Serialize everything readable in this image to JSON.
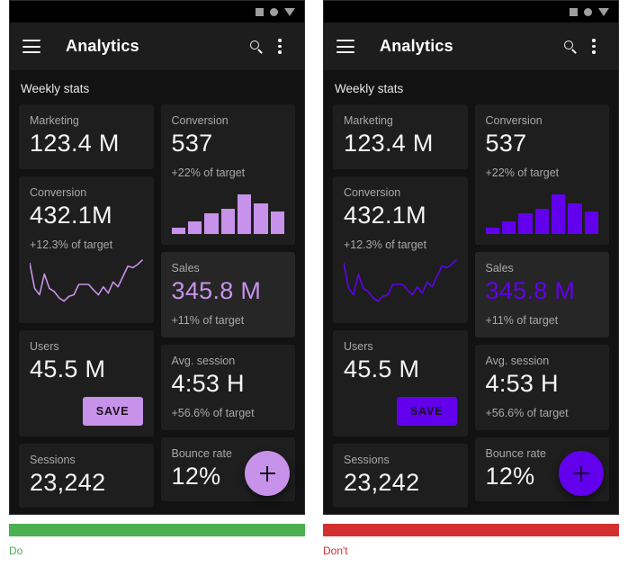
{
  "panels": [
    {
      "id": "do",
      "accent": "#c792ea",
      "verdict_color": "#4caf50",
      "verdict_label": "Do",
      "statusbar": {
        "icons": [
          "square-icon",
          "circle-icon",
          "triangle-down-icon"
        ]
      },
      "appbar": {
        "menu_icon": "hamburger-icon",
        "title": "Analytics",
        "search_icon": "search-icon",
        "overflow_icon": "more-vert-icon"
      },
      "section_title": "Weekly stats",
      "left_cards": [
        {
          "label": "Marketing",
          "value": "123.4 M",
          "sub": "",
          "type": "plain"
        },
        {
          "label": "Conversion",
          "value": "432.1M",
          "sub": "+12.3% of target",
          "type": "sparkline"
        },
        {
          "label": "Users",
          "value": "45.5 M",
          "sub": "",
          "type": "button",
          "button_label": "SAVE"
        },
        {
          "label": "Sessions",
          "value": "23,242",
          "sub": "",
          "type": "plain"
        }
      ],
      "right_cards": [
        {
          "label": "Conversion",
          "value": "537",
          "sub": "+22% of target",
          "type": "barchart"
        },
        {
          "label": "Sales",
          "value": "345.8 M",
          "sub": "+11% of target",
          "type": "accent"
        },
        {
          "label": "Avg. session",
          "value": "4:53 H",
          "sub": "+56.6% of target",
          "type": "plain"
        },
        {
          "label": "Bounce rate",
          "value": "12%",
          "sub": "",
          "type": "plain"
        }
      ],
      "fab": {
        "icon": "plus-icon"
      }
    },
    {
      "id": "dont",
      "accent": "#6200ee",
      "verdict_color": "#d32f2f",
      "verdict_label": "Don't",
      "statusbar": {
        "icons": [
          "square-icon",
          "circle-icon",
          "triangle-down-icon"
        ]
      },
      "appbar": {
        "menu_icon": "hamburger-icon",
        "title": "Analytics",
        "search_icon": "search-icon",
        "overflow_icon": "more-vert-icon"
      },
      "section_title": "Weekly stats",
      "left_cards": [
        {
          "label": "Marketing",
          "value": "123.4 M",
          "sub": "",
          "type": "plain"
        },
        {
          "label": "Conversion",
          "value": "432.1M",
          "sub": "+12.3% of target",
          "type": "sparkline"
        },
        {
          "label": "Users",
          "value": "45.5 M",
          "sub": "",
          "type": "button",
          "button_label": "SAVE"
        },
        {
          "label": "Sessions",
          "value": "23,242",
          "sub": "",
          "type": "plain"
        }
      ],
      "right_cards": [
        {
          "label": "Conversion",
          "value": "537",
          "sub": "+22% of target",
          "type": "barchart"
        },
        {
          "label": "Sales",
          "value": "345.8 M",
          "sub": "+11% of target",
          "type": "accent"
        },
        {
          "label": "Avg. session",
          "value": "4:53 H",
          "sub": "+56.6% of target",
          "type": "plain"
        },
        {
          "label": "Bounce rate",
          "value": "12%",
          "sub": "",
          "type": "plain"
        }
      ],
      "fab": {
        "icon": "plus-icon"
      }
    }
  ],
  "chart_data": [
    {
      "type": "bar",
      "title": "Conversion",
      "categories": [
        "1",
        "2",
        "3",
        "4",
        "5",
        "6",
        "7"
      ],
      "values": [
        10,
        20,
        32,
        40,
        62,
        48,
        35
      ],
      "xlabel": "",
      "ylabel": "",
      "ylim": [
        0,
        68
      ],
      "grid": false,
      "legend": "none"
    },
    {
      "type": "line",
      "title": "Conversion",
      "x": [
        0,
        1,
        2,
        3,
        4,
        5,
        6,
        7,
        8,
        9,
        10,
        11,
        12,
        13,
        14,
        15,
        16,
        17,
        18,
        19,
        20,
        21,
        22,
        23
      ],
      "values": [
        62,
        30,
        22,
        48,
        30,
        26,
        18,
        14,
        20,
        22,
        35,
        35,
        35,
        28,
        22,
        32,
        24,
        38,
        32,
        45,
        58,
        56,
        60,
        66
      ],
      "xlabel": "",
      "ylabel": "",
      "ylim": [
        0,
        70
      ],
      "grid": false,
      "legend": "none"
    }
  ]
}
